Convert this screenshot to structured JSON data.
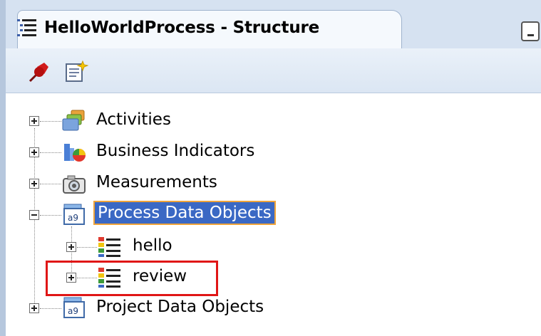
{
  "panel": {
    "title": "HelloWorldProcess - Structure"
  },
  "toolbar": {
    "buttons": [
      {
        "icon": "pin-icon"
      },
      {
        "icon": "new-note-icon"
      }
    ]
  },
  "tree": {
    "nodes": [
      {
        "label": "Activities",
        "expanded": false,
        "icon": "activities-icon"
      },
      {
        "label": "Business Indicators",
        "expanded": false,
        "icon": "business-indicators-icon"
      },
      {
        "label": "Measurements",
        "expanded": false,
        "icon": "camera-icon"
      },
      {
        "label": "Process Data Objects",
        "expanded": true,
        "selected": true,
        "icon": "data-objects-icon",
        "children": [
          {
            "label": "hello",
            "expanded": false,
            "icon": "data-object-icon"
          },
          {
            "label": "review",
            "expanded": false,
            "icon": "data-object-icon",
            "highlighted": true
          }
        ]
      },
      {
        "label": "Project Data Objects",
        "expanded": false,
        "icon": "data-objects-icon"
      }
    ]
  },
  "colors": {
    "selection": "#3a68c4",
    "highlight_box": "#e01616",
    "tab_strip": "#d6e2f1"
  }
}
